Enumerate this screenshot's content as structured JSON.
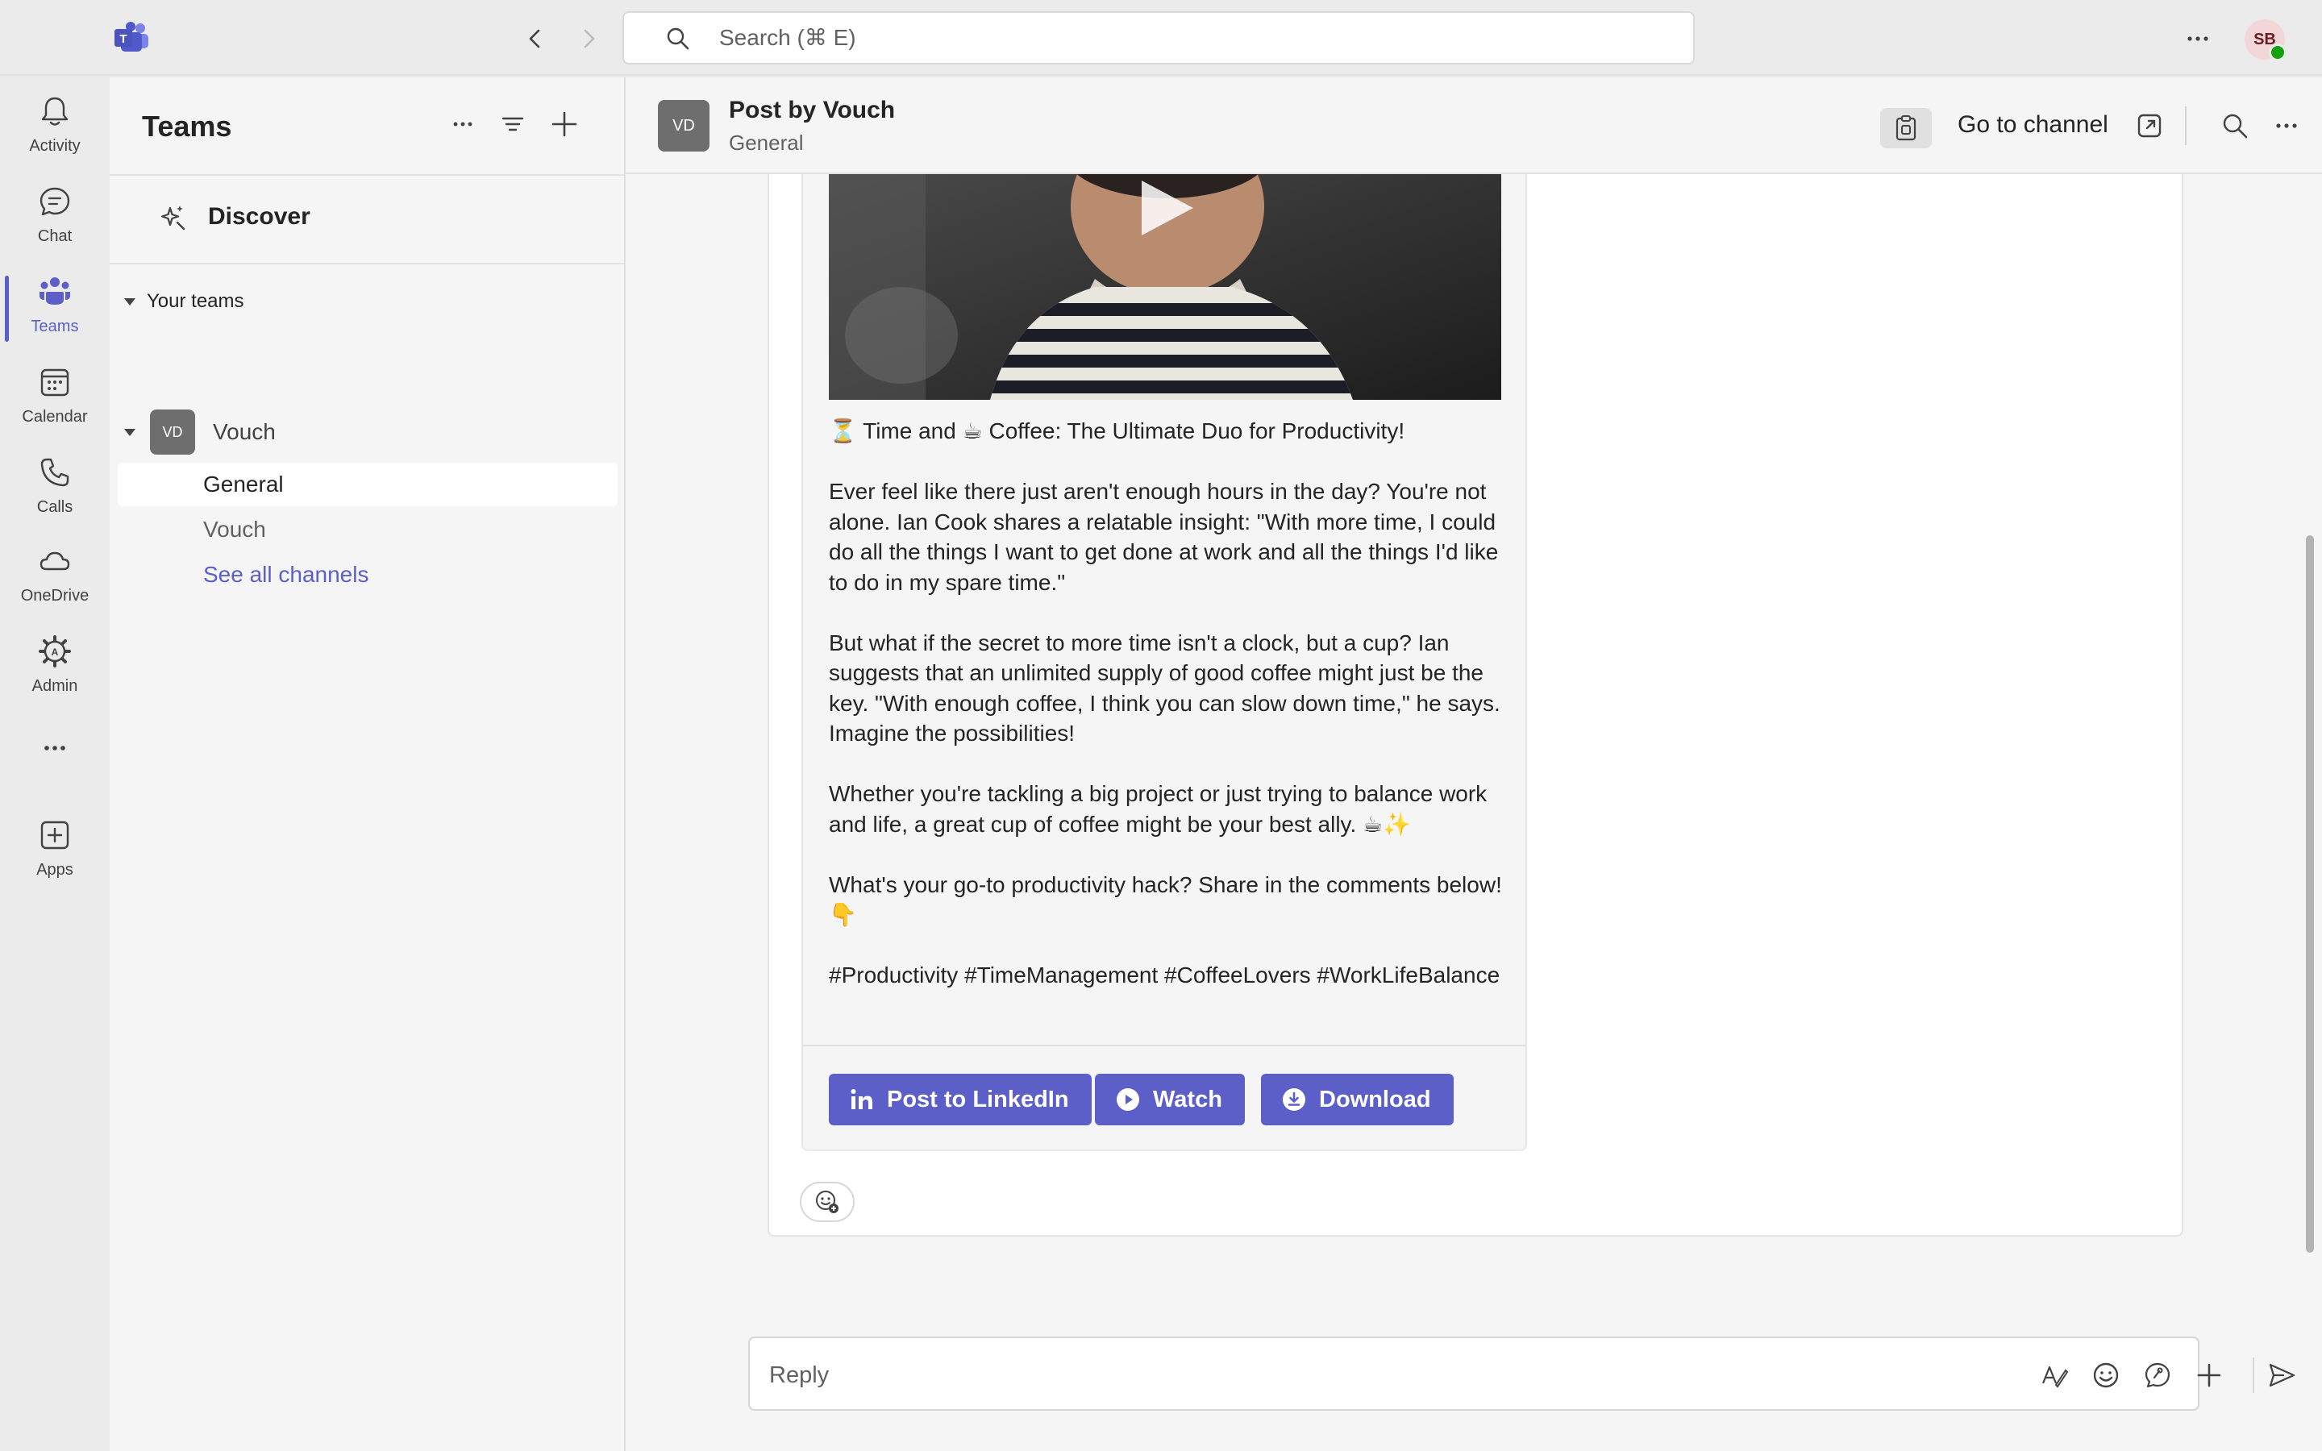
{
  "topbar": {
    "search_placeholder": "Search (⌘ E)",
    "avatar_initials": "SB"
  },
  "rail": {
    "items": [
      {
        "label": "Activity",
        "icon": "bell-icon"
      },
      {
        "label": "Chat",
        "icon": "chat-icon"
      },
      {
        "label": "Teams",
        "icon": "teams-icon"
      },
      {
        "label": "Calendar",
        "icon": "calendar-icon"
      },
      {
        "label": "Calls",
        "icon": "phone-icon"
      },
      {
        "label": "OneDrive",
        "icon": "cloud-icon"
      },
      {
        "label": "Admin",
        "icon": "admin-gear-icon"
      },
      {
        "label": "",
        "icon": "more-icon"
      },
      {
        "label": "Apps",
        "icon": "add-app-icon"
      }
    ],
    "active": "Teams"
  },
  "teams_panel": {
    "title": "Teams",
    "discover_label": "Discover",
    "your_teams_label": "Your teams",
    "team": {
      "name": "Vouch",
      "avatar_initials": "VD"
    },
    "channels": [
      {
        "label": "General",
        "selected": true
      },
      {
        "label": "Vouch",
        "selected": false
      },
      {
        "label": "See all channels",
        "selected": false
      }
    ]
  },
  "main": {
    "header": {
      "avatar_initials": "VD",
      "title": "Post by Vouch",
      "subtitle": "General",
      "go_to_channel": "Go to channel"
    },
    "post": {
      "paragraphs": [
        "⏳ Time and ☕ Coffee: The Ultimate Duo for Productivity!",
        "Ever feel like there just aren't enough hours in the day? You're not alone. Ian Cook shares a relatable insight: \"With more time, I could do all the things I want to get done at work and all the things I'd like to do in my spare time.\"",
        "But what if the secret to more time isn't a clock, but a cup? Ian suggests that an unlimited supply of good coffee might just be the key. \"With enough coffee, I think you can slow down time,\" he says. Imagine the possibilities!",
        "Whether you're tackling a big project or just trying to balance work and life, a great cup of coffee might be your best ally. ☕✨",
        "What's your go-to productivity hack? Share in the comments below! 👇",
        "#Productivity #TimeManagement #CoffeeLovers #WorkLifeBalance"
      ],
      "buttons": [
        {
          "label": "Post to LinkedIn",
          "icon": "linkedin-icon"
        },
        {
          "label": "Watch",
          "icon": "play-circle-icon"
        },
        {
          "label": "Download",
          "icon": "download-icon"
        }
      ]
    },
    "reply_placeholder": "Reply"
  },
  "colors": {
    "accent": "#5b5fc7",
    "rail_bg": "#ebebeb",
    "panel_bg": "#f5f5f5",
    "presence_available": "#13a10e"
  }
}
